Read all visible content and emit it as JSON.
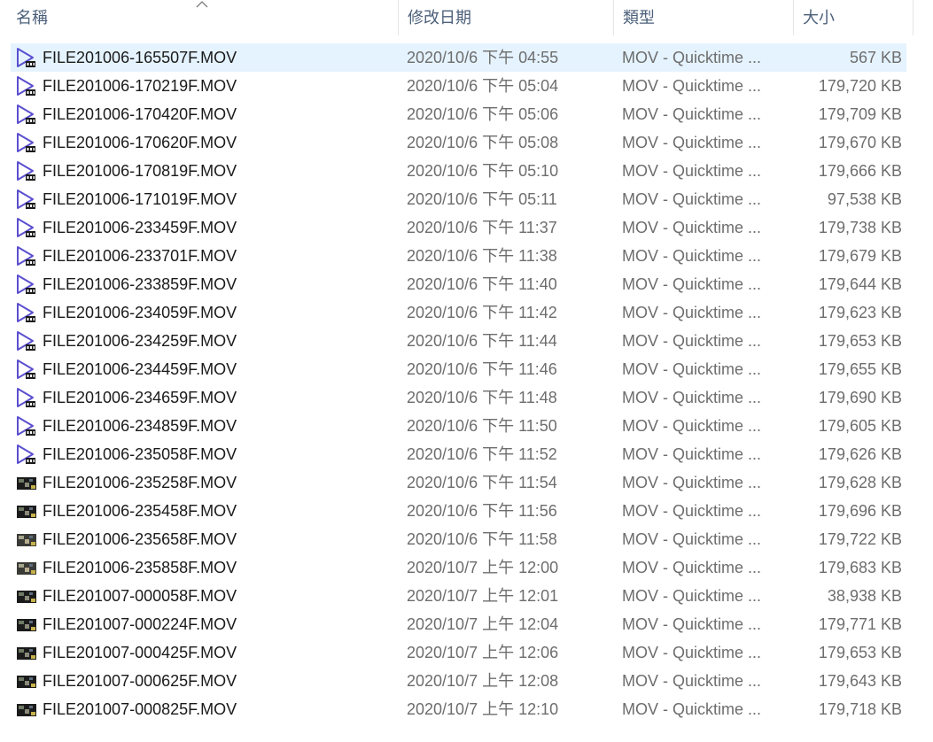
{
  "columns": {
    "name": "名稱",
    "modified": "修改日期",
    "type": "類型",
    "size": "大小"
  },
  "sort_icon": "chevron-up-icon",
  "colors": {
    "selected_row": "#e5f3ff",
    "play_icon": "#5a4fcf",
    "header_text": "#4c607a"
  },
  "files": [
    {
      "name": "FILE201006-165507F.MOV",
      "date": "2020/10/6 下午 04:55",
      "type": "MOV - Quicktime ...",
      "size": "567 KB",
      "icon": "video-play-icon",
      "selected": true
    },
    {
      "name": "FILE201006-170219F.MOV",
      "date": "2020/10/6 下午 05:04",
      "type": "MOV - Quicktime ...",
      "size": "179,720 KB",
      "icon": "video-play-icon"
    },
    {
      "name": "FILE201006-170420F.MOV",
      "date": "2020/10/6 下午 05:06",
      "type": "MOV - Quicktime ...",
      "size": "179,709 KB",
      "icon": "video-play-icon"
    },
    {
      "name": "FILE201006-170620F.MOV",
      "date": "2020/10/6 下午 05:08",
      "type": "MOV - Quicktime ...",
      "size": "179,670 KB",
      "icon": "video-play-icon"
    },
    {
      "name": "FILE201006-170819F.MOV",
      "date": "2020/10/6 下午 05:10",
      "type": "MOV - Quicktime ...",
      "size": "179,666 KB",
      "icon": "video-play-icon"
    },
    {
      "name": "FILE201006-171019F.MOV",
      "date": "2020/10/6 下午 05:11",
      "type": "MOV - Quicktime ...",
      "size": "97,538 KB",
      "icon": "video-play-icon"
    },
    {
      "name": "FILE201006-233459F.MOV",
      "date": "2020/10/6 下午 11:37",
      "type": "MOV - Quicktime ...",
      "size": "179,738 KB",
      "icon": "video-play-icon"
    },
    {
      "name": "FILE201006-233701F.MOV",
      "date": "2020/10/6 下午 11:38",
      "type": "MOV - Quicktime ...",
      "size": "179,679 KB",
      "icon": "video-play-icon"
    },
    {
      "name": "FILE201006-233859F.MOV",
      "date": "2020/10/6 下午 11:40",
      "type": "MOV - Quicktime ...",
      "size": "179,644 KB",
      "icon": "video-play-icon"
    },
    {
      "name": "FILE201006-234059F.MOV",
      "date": "2020/10/6 下午 11:42",
      "type": "MOV - Quicktime ...",
      "size": "179,623 KB",
      "icon": "video-play-icon"
    },
    {
      "name": "FILE201006-234259F.MOV",
      "date": "2020/10/6 下午 11:44",
      "type": "MOV - Quicktime ...",
      "size": "179,653 KB",
      "icon": "video-play-icon"
    },
    {
      "name": "FILE201006-234459F.MOV",
      "date": "2020/10/6 下午 11:46",
      "type": "MOV - Quicktime ...",
      "size": "179,655 KB",
      "icon": "video-play-icon"
    },
    {
      "name": "FILE201006-234659F.MOV",
      "date": "2020/10/6 下午 11:48",
      "type": "MOV - Quicktime ...",
      "size": "179,690 KB",
      "icon": "video-play-icon"
    },
    {
      "name": "FILE201006-234859F.MOV",
      "date": "2020/10/6 下午 11:50",
      "type": "MOV - Quicktime ...",
      "size": "179,605 KB",
      "icon": "video-play-icon"
    },
    {
      "name": "FILE201006-235058F.MOV",
      "date": "2020/10/6 下午 11:52",
      "type": "MOV - Quicktime ...",
      "size": "179,626 KB",
      "icon": "video-play-icon"
    },
    {
      "name": "FILE201006-235258F.MOV",
      "date": "2020/10/6 下午 11:54",
      "type": "MOV - Quicktime ...",
      "size": "179,628 KB",
      "icon": "video-thumbnail-icon"
    },
    {
      "name": "FILE201006-235458F.MOV",
      "date": "2020/10/6 下午 11:56",
      "type": "MOV - Quicktime ...",
      "size": "179,696 KB",
      "icon": "video-thumbnail-icon"
    },
    {
      "name": "FILE201006-235658F.MOV",
      "date": "2020/10/6 下午 11:58",
      "type": "MOV - Quicktime ...",
      "size": "179,722 KB",
      "icon": "video-thumbnail-icon",
      "light": true
    },
    {
      "name": "FILE201006-235858F.MOV",
      "date": "2020/10/7 上午 12:00",
      "type": "MOV - Quicktime ...",
      "size": "179,683 KB",
      "icon": "video-thumbnail-icon",
      "light": true
    },
    {
      "name": "FILE201007-000058F.MOV",
      "date": "2020/10/7 上午 12:01",
      "type": "MOV - Quicktime ...",
      "size": "38,938 KB",
      "icon": "video-thumbnail-icon"
    },
    {
      "name": "FILE201007-000224F.MOV",
      "date": "2020/10/7 上午 12:04",
      "type": "MOV - Quicktime ...",
      "size": "179,771 KB",
      "icon": "video-thumbnail-icon"
    },
    {
      "name": "FILE201007-000425F.MOV",
      "date": "2020/10/7 上午 12:06",
      "type": "MOV - Quicktime ...",
      "size": "179,653 KB",
      "icon": "video-thumbnail-icon"
    },
    {
      "name": "FILE201007-000625F.MOV",
      "date": "2020/10/7 上午 12:08",
      "type": "MOV - Quicktime ...",
      "size": "179,643 KB",
      "icon": "video-thumbnail-icon"
    },
    {
      "name": "FILE201007-000825F.MOV",
      "date": "2020/10/7 上午 12:10",
      "type": "MOV - Quicktime ...",
      "size": "179,718 KB",
      "icon": "video-thumbnail-icon"
    }
  ]
}
